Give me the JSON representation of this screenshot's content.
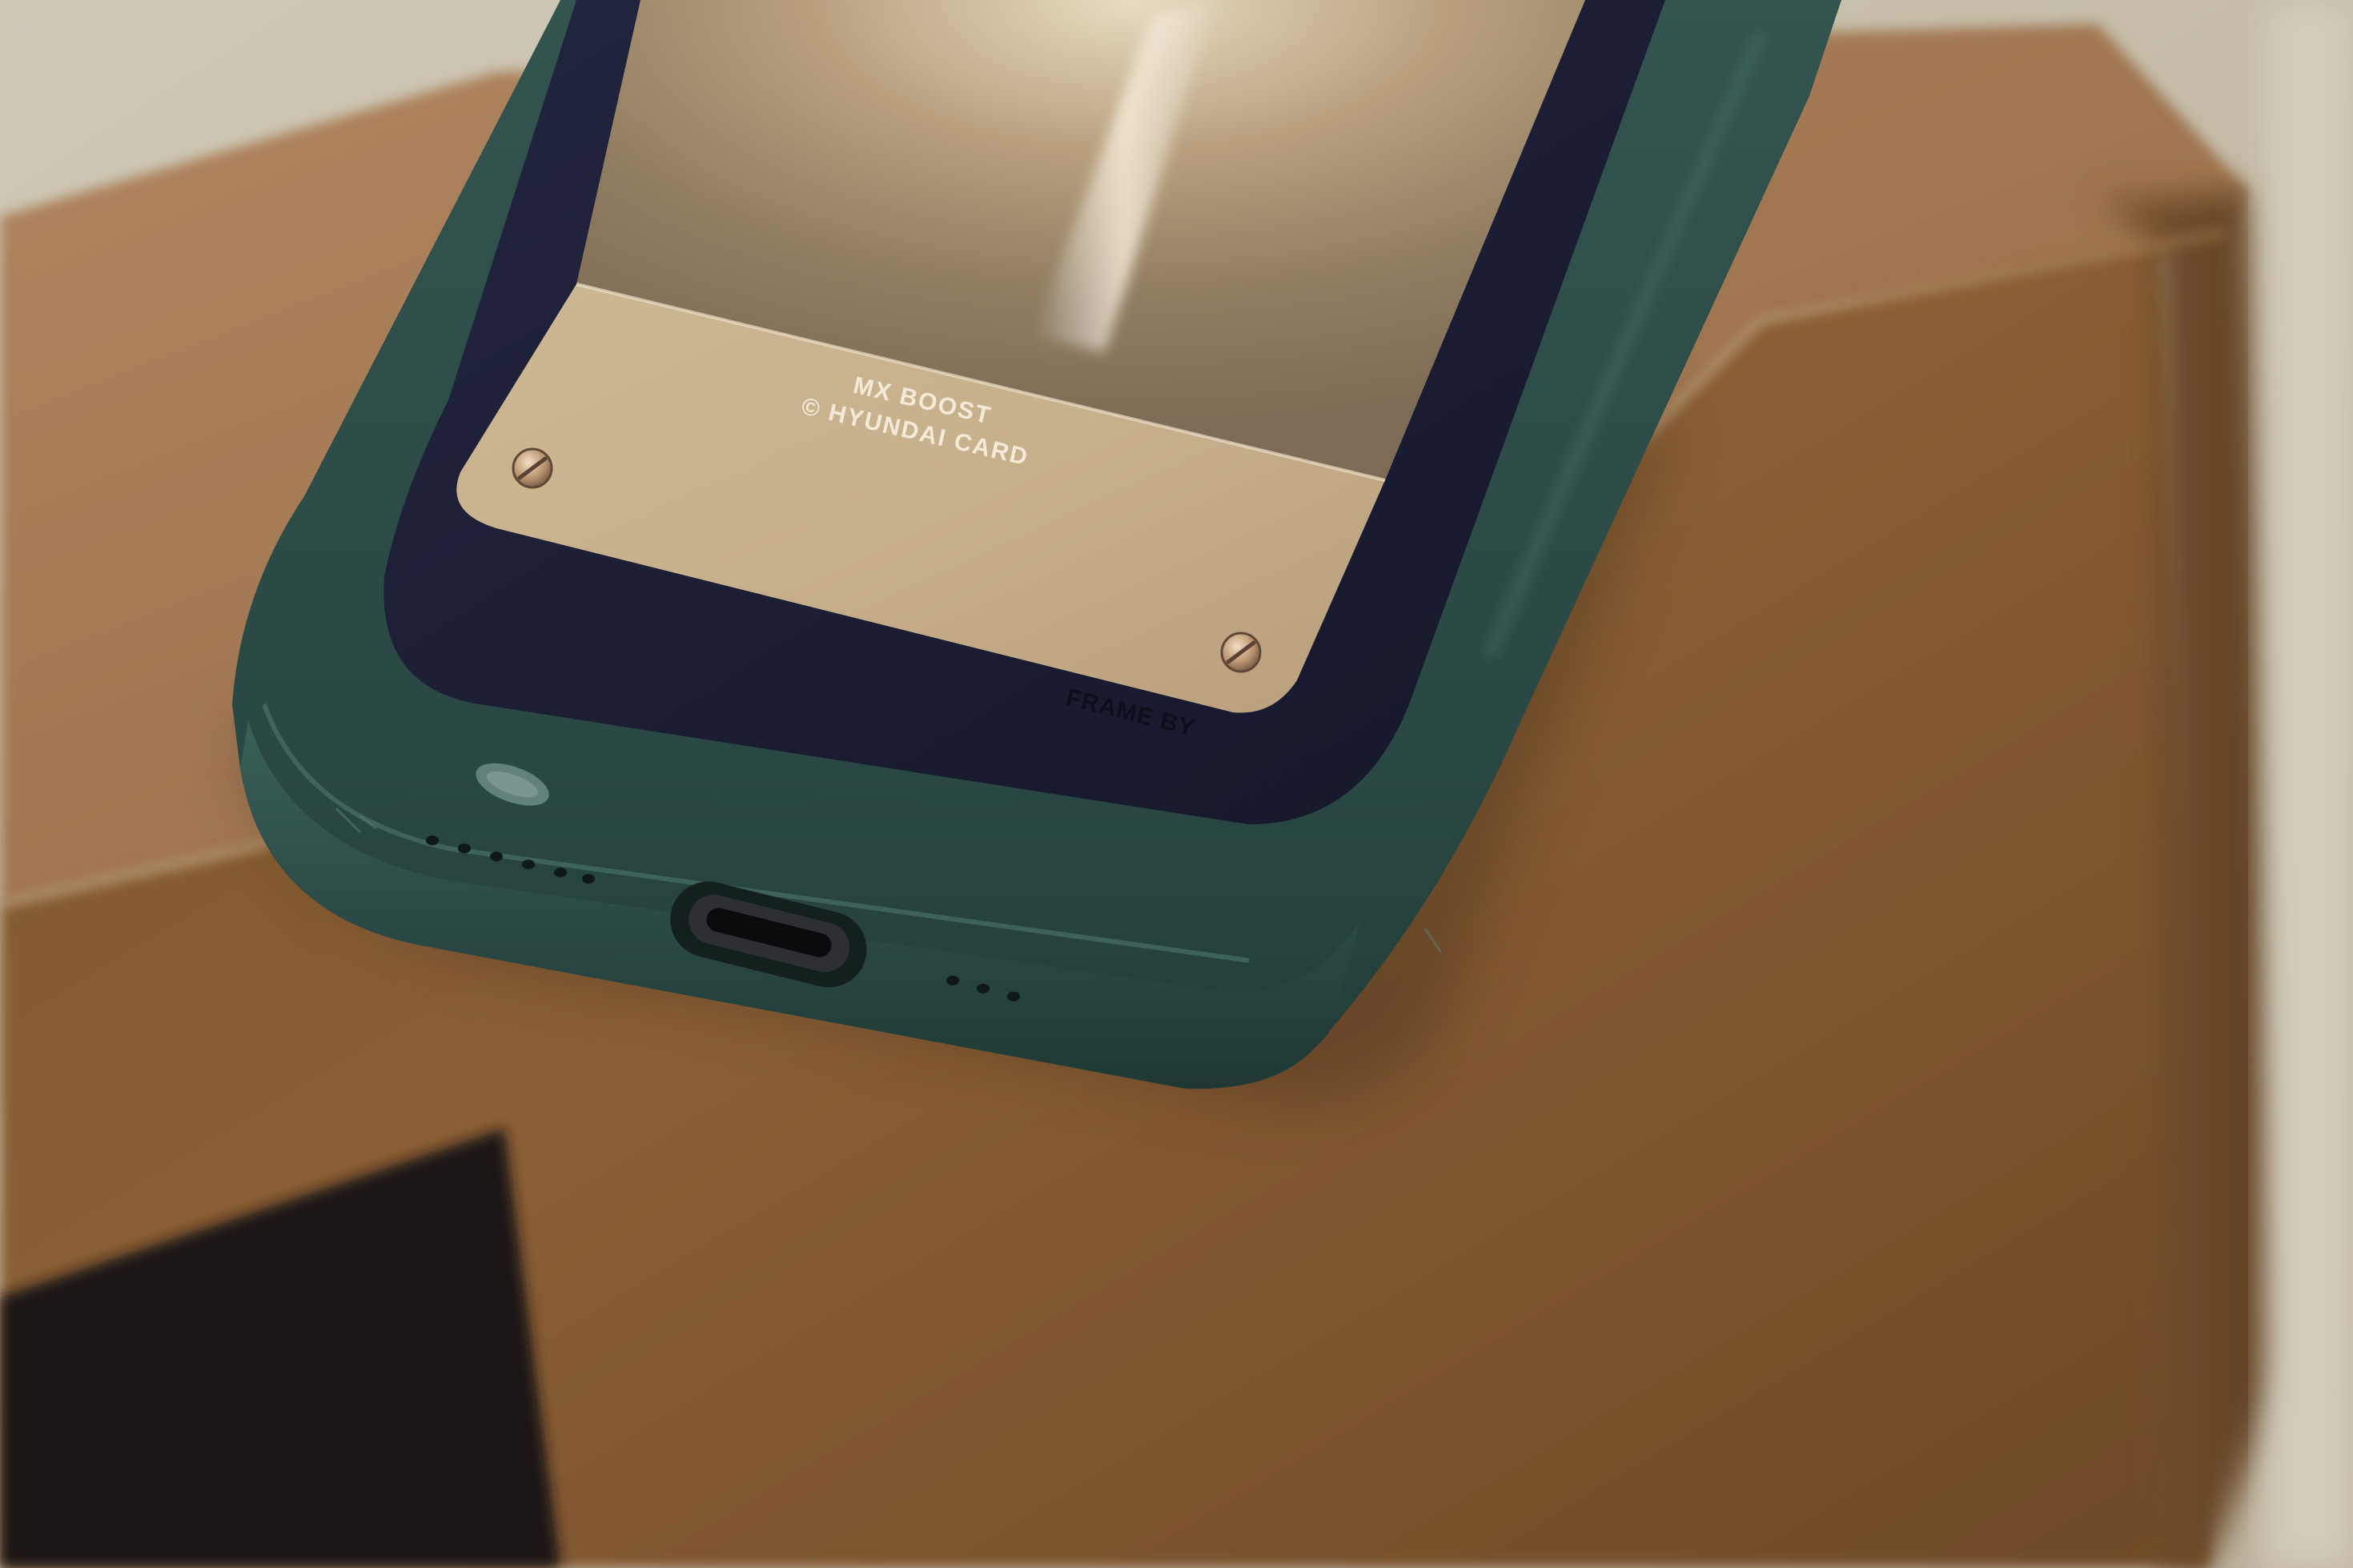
{
  "photo": {
    "card": {
      "line1": "MX BOOST",
      "line2": "© HYUNDAI CARD"
    },
    "frame_engraving": "FRAME BY"
  },
  "colors": {
    "wall_background": "#c9c2ae",
    "box_cardboard": "#8a6236",
    "box_top_face": "#a57a52",
    "case_green": "#2b4a45",
    "inner_frame_navy": "#1b1d33",
    "card_gold": "#c9b491",
    "black_sleeve": "#1a1714"
  },
  "icons": [
    "screw-icon",
    "usb-c-port-icon",
    "speaker-hole-icon"
  ]
}
